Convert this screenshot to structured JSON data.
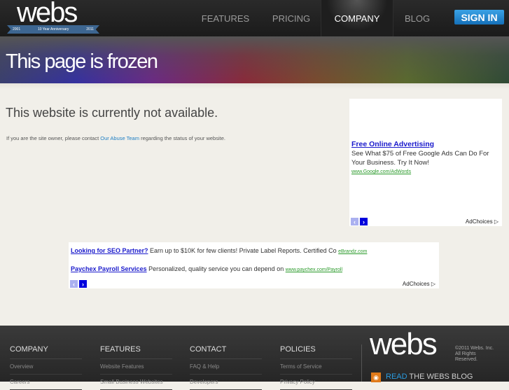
{
  "header": {
    "logo": "webs",
    "ribbon": {
      "start": "2001",
      "label": "10 Year Anniversary",
      "end": "2011"
    },
    "nav": [
      {
        "label": "FEATURES"
      },
      {
        "label": "PRICING"
      },
      {
        "label": "COMPANY"
      },
      {
        "label": "BLOG"
      }
    ],
    "signin": "SIGN IN"
  },
  "banner": {
    "title": "This page is frozen"
  },
  "main": {
    "headline": "This website is currently not available.",
    "note_before": "If you are the site owner, please contact ",
    "note_link": "Our Abuse Team",
    "note_after": " regarding the status of your website."
  },
  "ad_side": {
    "title": "Free Online Advertising",
    "body": "See What $75 of Free Google Ads Can Do For Your Business. Try It Now!",
    "url": "www.Google.com/AdWords",
    "adchoices": "AdChoices"
  },
  "ad_wide": {
    "items": [
      {
        "title": "Looking for SEO Partner?",
        "body": " Earn up to $10K for few clients! Private Label Reports. Certified Co ",
        "url": "eBrandz.com"
      },
      {
        "title": "Paychex Payroll Services",
        "body": " Personalized, quality service you can depend on ",
        "url": "www.paychex.com/Payroll"
      }
    ],
    "adchoices": "AdChoices"
  },
  "footer": {
    "columns": [
      {
        "title": "COMPANY",
        "links": [
          "Overview",
          "Careers"
        ]
      },
      {
        "title": "FEATURES",
        "links": [
          "Website Features",
          "Small Business Websites"
        ]
      },
      {
        "title": "CONTACT",
        "links": [
          "FAQ & Help",
          "Developers"
        ]
      },
      {
        "title": "POLICIES",
        "links": [
          "Terms of Service",
          "Privacy Policy"
        ]
      }
    ],
    "logo": "webs",
    "copyright": "©2011 Webs. Inc. All Rights Reserved.",
    "blog_read": "READ",
    "blog_rest": " THE WEBS BLOG"
  }
}
